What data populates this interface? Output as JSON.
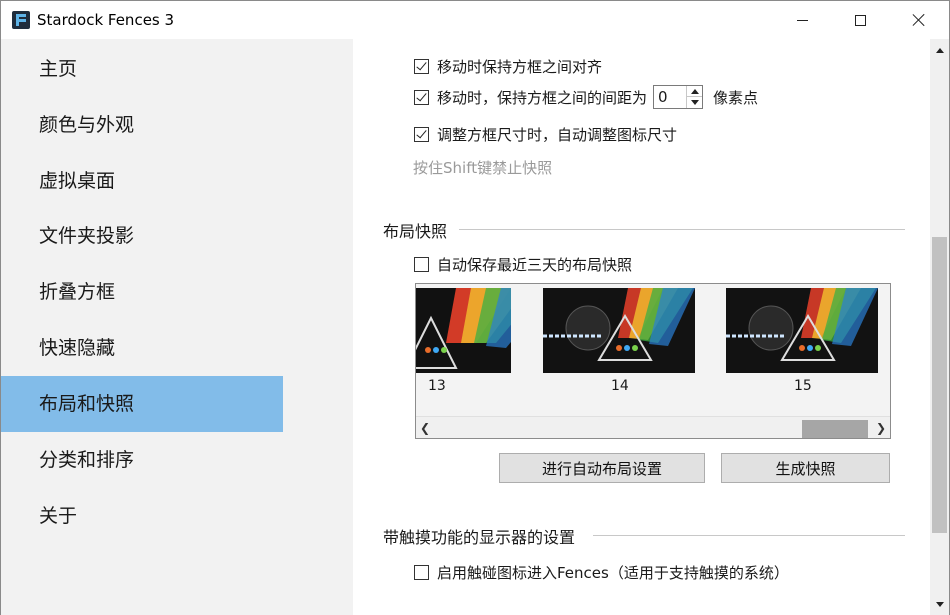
{
  "window": {
    "title": "Stardock Fences 3",
    "minimize_icon": "minimize-icon",
    "maximize_icon": "maximize-icon",
    "close_icon": "close-icon"
  },
  "sidebar": {
    "items": [
      {
        "label": "主页",
        "active": false
      },
      {
        "label": "颜色与外观",
        "active": false
      },
      {
        "label": "虚拟桌面",
        "active": false
      },
      {
        "label": "文件夹投影",
        "active": false
      },
      {
        "label": "折叠方框",
        "active": false
      },
      {
        "label": "快速隐藏",
        "active": false
      },
      {
        "label": "布局和快照",
        "active": true
      },
      {
        "label": "分类和排序",
        "active": false
      },
      {
        "label": "关于",
        "active": false
      }
    ],
    "active_color": "#82bce9"
  },
  "snap": {
    "align_label": "移动时保持方框之间对齐",
    "align_checked": true,
    "spacing_label": "移动时，保持方框之间的间距为",
    "spacing_checked": true,
    "spacing_value": "0",
    "spacing_unit": "像素点",
    "resize_label": "调整方框尺寸时，自动调整图标尺寸",
    "resize_checked": true,
    "hint": "按住Shift键禁止快照"
  },
  "layout_snapshots": {
    "title": "布局快照",
    "autosave_label": "自动保存最近三天的布局快照",
    "autosave_checked": false,
    "snapshots": [
      {
        "label": "13"
      },
      {
        "label": "14"
      },
      {
        "label": "15"
      }
    ],
    "auto_layout_button": "进行自动布局设置",
    "create_snapshot_button": "生成快照"
  },
  "touch": {
    "title": "带触摸功能的显示器的设置",
    "enable_label": "启用触碰图标进入Fences（适用于支持触摸的系统）",
    "enable_checked": false
  }
}
